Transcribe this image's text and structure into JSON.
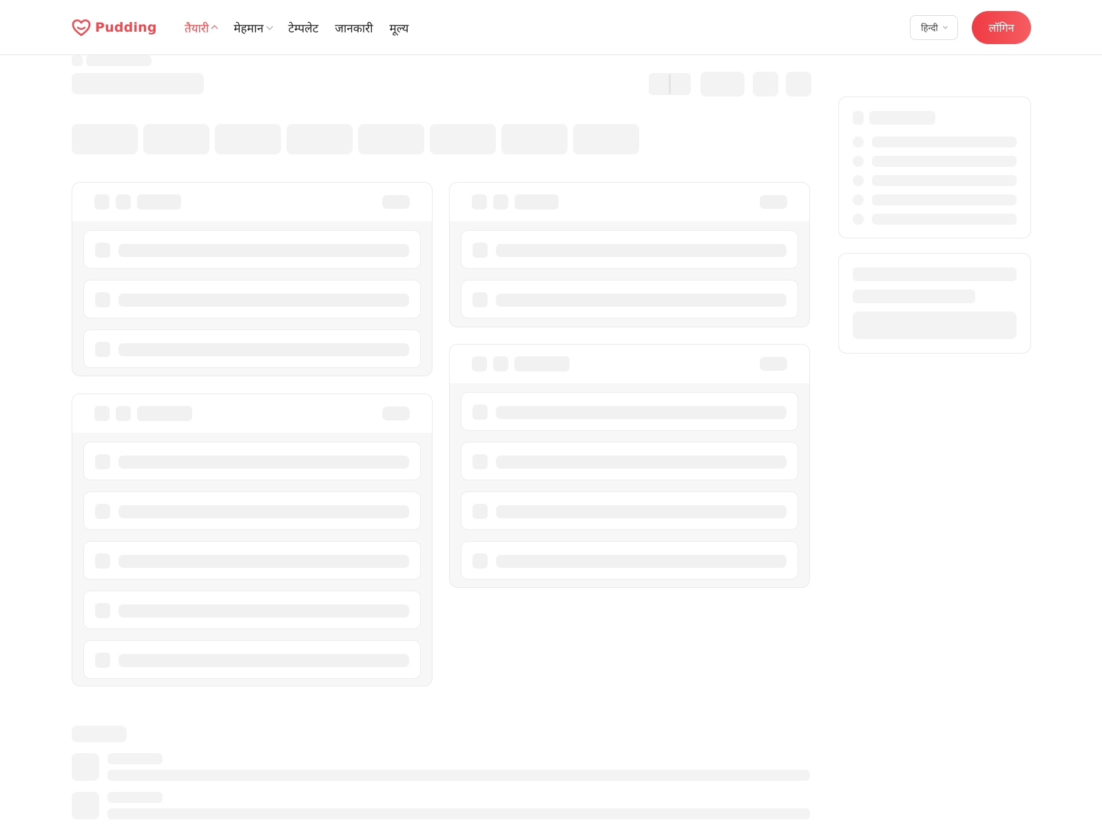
{
  "header": {
    "brand": "Pudding",
    "nav": [
      {
        "label": "तैयारी",
        "active": true,
        "chevron": "chevron-up-icon"
      },
      {
        "label": "मेहमान",
        "active": false,
        "chevron": "chevron-down-icon"
      },
      {
        "label": "टेम्पलेट",
        "active": false
      },
      {
        "label": "जानकारी",
        "active": false
      },
      {
        "label": "मूल्य",
        "active": false
      }
    ],
    "language": "हिन्दी",
    "login_label": "लॉगिन"
  },
  "colors": {
    "accent": "#ee4a4f",
    "skeleton": "#f3f3f3",
    "card_bg": "#f7f7f7",
    "border": "#e9e9e9"
  },
  "state": "loading-skeleton"
}
